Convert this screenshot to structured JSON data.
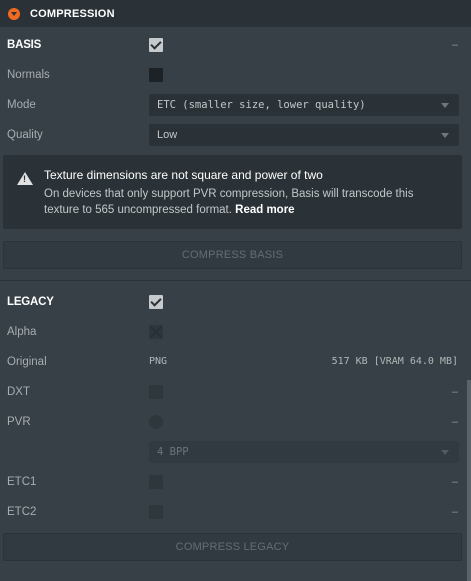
{
  "panel": {
    "title": "COMPRESSION",
    "icon": "collapse-arrow-icon"
  },
  "basis": {
    "label": "BASIS",
    "enabled": true,
    "collapse_label": "–",
    "normals": {
      "label": "Normals",
      "checked": false
    },
    "mode": {
      "label": "Mode",
      "value": "ETC (smaller size, lower quality)"
    },
    "quality": {
      "label": "Quality",
      "value": "Low"
    },
    "warning": {
      "icon": "warning-icon",
      "title": "Texture dimensions are not square and power of two",
      "body": "On devices that only support PVR compression, Basis will transcode this texture to 565 uncompressed format.",
      "link": "Read more"
    },
    "compress_button": "COMPRESS BASIS"
  },
  "legacy": {
    "label": "LEGACY",
    "enabled": true,
    "alpha": {
      "label": "Alpha"
    },
    "original": {
      "label": "Original",
      "format": "PNG",
      "size": "517 KB [VRAM 64.0 MB]"
    },
    "dxt": {
      "label": "DXT",
      "value": "–"
    },
    "pvr": {
      "label": "PVR",
      "value": "–",
      "bpp": "4 BPP"
    },
    "etc1": {
      "label": "ETC1",
      "value": "–"
    },
    "etc2": {
      "label": "ETC2",
      "value": "–"
    },
    "compress_button": "COMPRESS LEGACY"
  },
  "colors": {
    "background": "#364046",
    "header": "#2a3237",
    "accent": "#f26a21"
  }
}
